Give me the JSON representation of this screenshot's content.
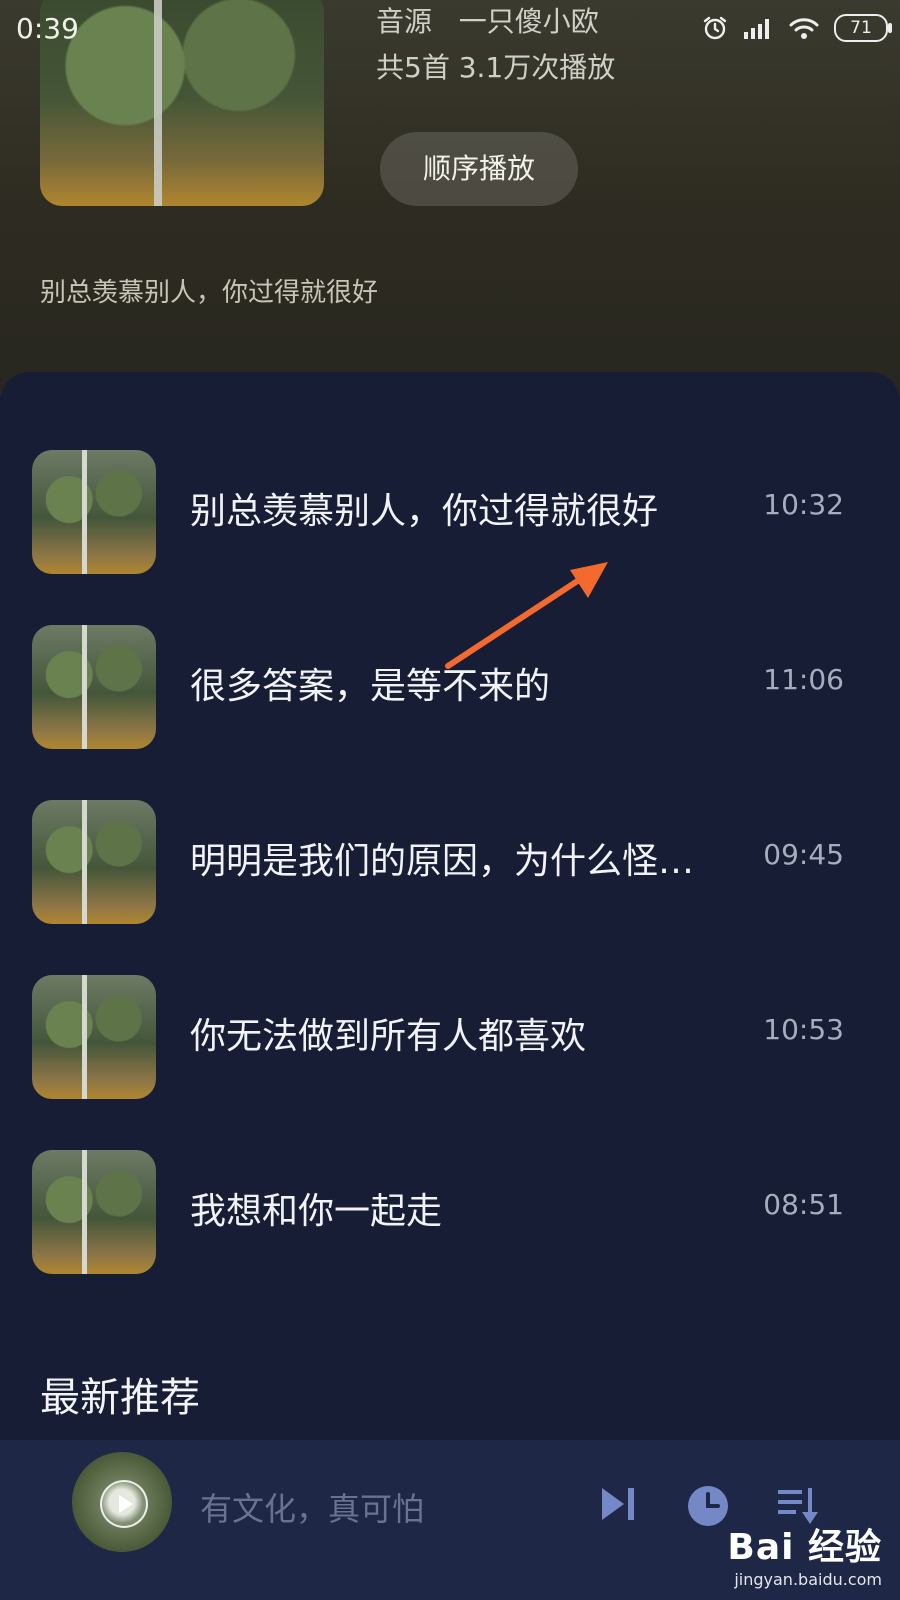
{
  "status_bar": {
    "time": "0:39",
    "battery": "71",
    "icons": [
      "alarm-icon",
      "signal-icon",
      "wifi-icon",
      "battery-icon"
    ]
  },
  "album": {
    "source_label": "音源",
    "source_name": "一只傻小欧",
    "stats": "共5首  3.1万次播放",
    "play_order_label": "顺序播放",
    "description": "别总羡慕别人，你过得就很好"
  },
  "tracks": [
    {
      "title": "别总羡慕别人，你过得就很好",
      "duration": "10:32"
    },
    {
      "title": "很多答案，是等不来的",
      "duration": "11:06"
    },
    {
      "title": "明明是我们的原因，为什么怪…",
      "duration": "09:45"
    },
    {
      "title": "你无法做到所有人都喜欢",
      "duration": "10:53"
    },
    {
      "title": "我想和你一起走",
      "duration": "08:51"
    }
  ],
  "section_title": "最新推荐",
  "now_playing": {
    "title": "有文化，真可怕",
    "controls": [
      "next-icon",
      "timer-icon",
      "playlist-icon"
    ]
  },
  "watermark": {
    "brand": "Bai 经验",
    "url": "jingyan.baidu.com"
  },
  "annotation": {
    "color": "#f26a2e"
  }
}
